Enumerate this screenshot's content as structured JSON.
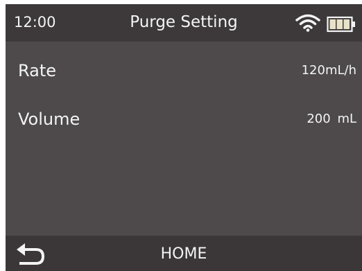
{
  "status": {
    "time": "12:00",
    "title": "Purge Setting",
    "wifi_icon": "wifi-icon",
    "battery_icon": "battery-icon",
    "battery_color": "#e8e3c8"
  },
  "settings": [
    {
      "label": "Rate",
      "value": "120mL/h",
      "unit": ""
    },
    {
      "label": "Volume",
      "value": "200",
      "unit": "mL"
    }
  ],
  "bottom": {
    "back_icon": "back-arrow-icon",
    "home_label": "HOME"
  },
  "colors": {
    "screen_bg": "#4e4a4b",
    "bar_bg": "#3d393a",
    "text": "#f4f4f4"
  }
}
